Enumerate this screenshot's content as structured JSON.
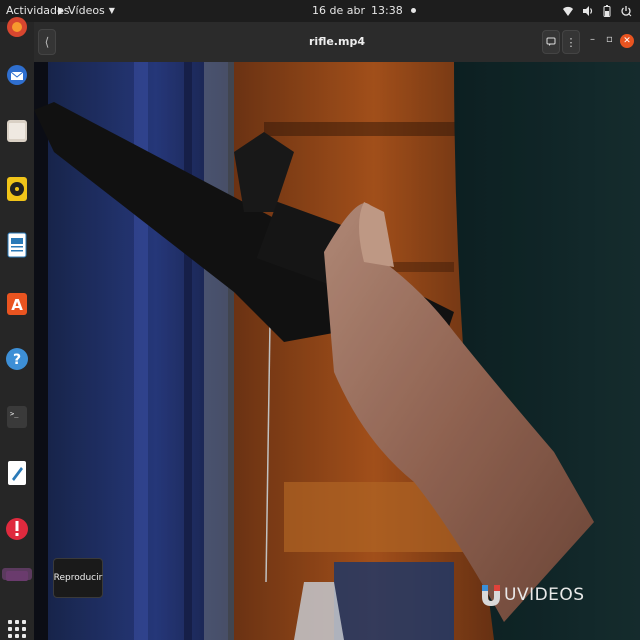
{
  "topbar": {
    "activities": "Actividades",
    "app_name": "Vídeos",
    "date": "16 de abr",
    "time": "13:38"
  },
  "dock": {
    "items": [
      "firefox-icon",
      "thunderbird-icon",
      "files-icon",
      "rhythmbox-icon",
      "writer-icon",
      "software-icon",
      "help-icon",
      "terminal-icon",
      "text-editor-icon",
      "update-icon",
      "videos-icon",
      "apps-grid-icon"
    ]
  },
  "window": {
    "title": "rifle.mp4"
  },
  "player": {
    "play_tooltip": "Reproducir",
    "watermark": "UVIDEOS"
  },
  "colors": {
    "accent": "#e95420",
    "dock_bg": "#262626",
    "topbar_bg": "#1d1d1d"
  }
}
